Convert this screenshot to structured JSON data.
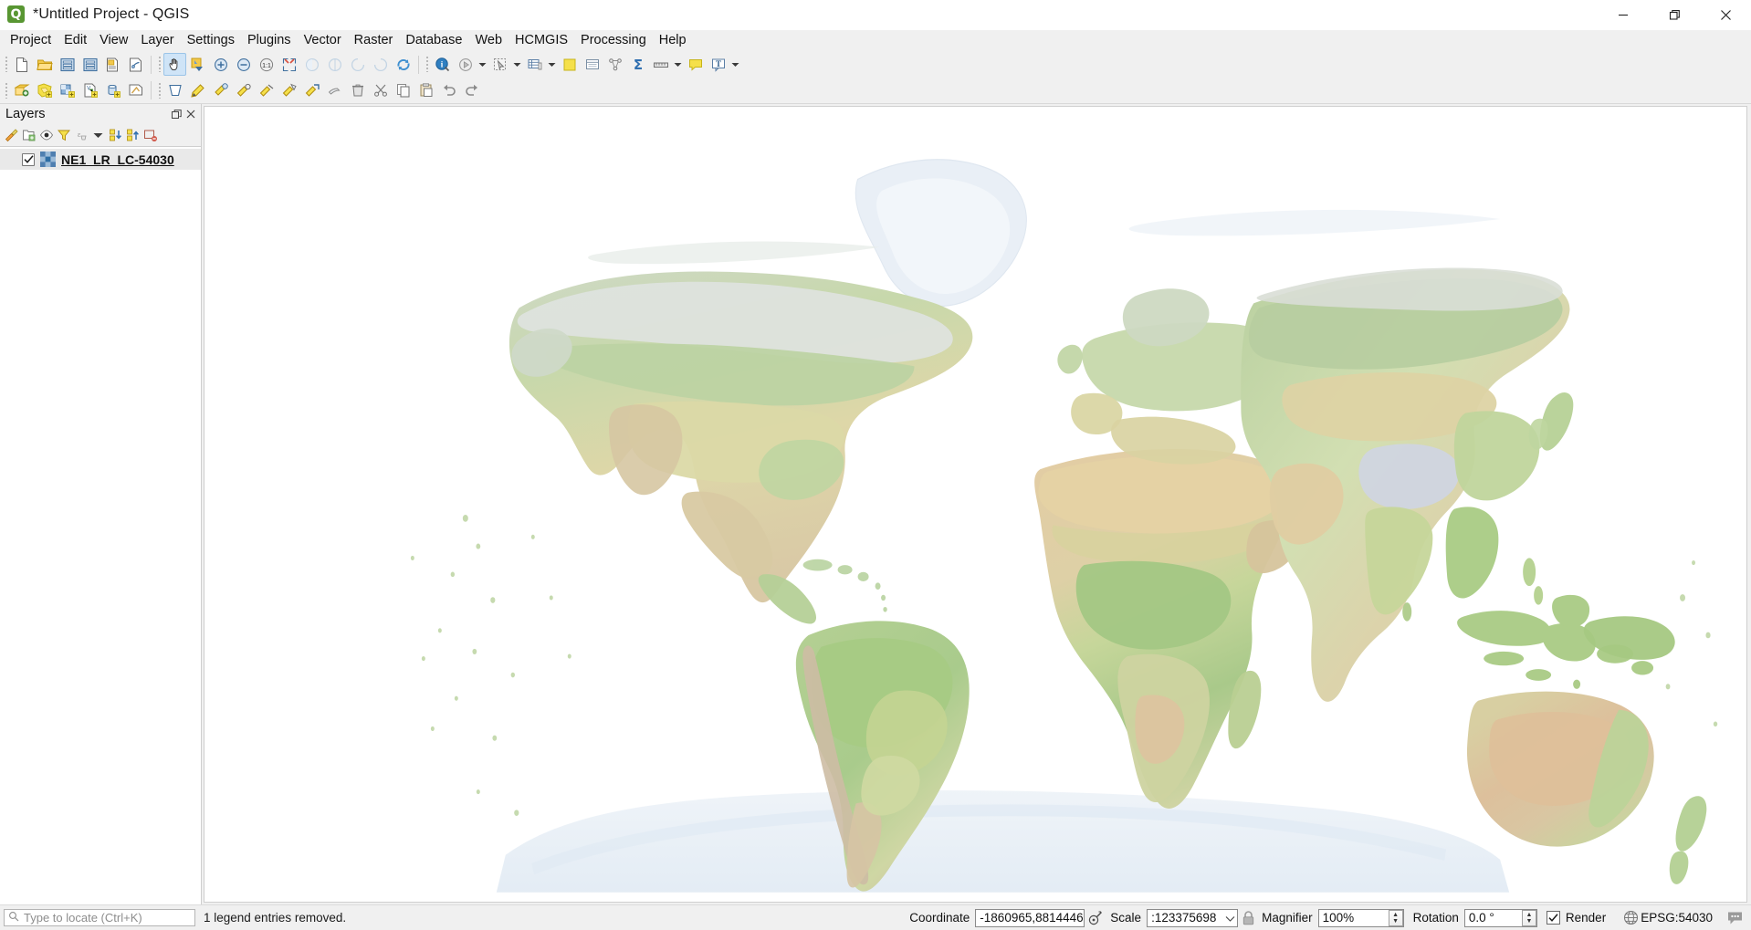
{
  "window": {
    "title": "*Untitled Project - QGIS",
    "app_icon": "qgis-logo-icon",
    "minimize_label": "Minimize",
    "maximize_label": "Restore",
    "close_label": "Close"
  },
  "menubar": {
    "items": [
      {
        "label": "Project"
      },
      {
        "label": "Edit"
      },
      {
        "label": "View"
      },
      {
        "label": "Layer"
      },
      {
        "label": "Settings"
      },
      {
        "label": "Plugins"
      },
      {
        "label": "Vector"
      },
      {
        "label": "Raster"
      },
      {
        "label": "Database"
      },
      {
        "label": "Web"
      },
      {
        "label": "HCMGIS"
      },
      {
        "label": "Processing"
      },
      {
        "label": "Help"
      }
    ]
  },
  "toolbar_project": {
    "buttons": [
      {
        "name": "new-project-icon",
        "tip": "New Project"
      },
      {
        "name": "open-project-icon",
        "tip": "Open Project"
      },
      {
        "name": "save-project-icon",
        "tip": "Save Project"
      },
      {
        "name": "save-project-as-icon",
        "tip": "Save Project As"
      },
      {
        "name": "new-print-layout-icon",
        "tip": "New Print Layout"
      },
      {
        "name": "show-layout-manager-icon",
        "tip": "Show Layout Manager"
      }
    ]
  },
  "toolbar_navigation": {
    "buttons": [
      {
        "name": "pan-map-icon",
        "tip": "Pan Map",
        "active": true
      },
      {
        "name": "pan-to-selection-icon",
        "tip": "Pan Map to Selection"
      },
      {
        "name": "zoom-in-icon",
        "tip": "Zoom In"
      },
      {
        "name": "zoom-out-icon",
        "tip": "Zoom Out"
      },
      {
        "name": "zoom-native-icon",
        "tip": "Zoom to Native Resolution",
        "glyph": "1:1"
      },
      {
        "name": "zoom-full-icon",
        "tip": "Zoom Full"
      },
      {
        "name": "zoom-to-selection-icon",
        "tip": "Zoom to Selection"
      },
      {
        "name": "zoom-to-layer-icon",
        "tip": "Zoom to Layer"
      },
      {
        "name": "zoom-last-icon",
        "tip": "Zoom Last"
      },
      {
        "name": "zoom-next-icon",
        "tip": "Zoom Next"
      },
      {
        "name": "refresh-icon",
        "tip": "Refresh"
      }
    ]
  },
  "toolbar_attributes": {
    "buttons": [
      {
        "name": "identify-features-icon",
        "tip": "Identify Features"
      },
      {
        "name": "run-feature-action-icon",
        "tip": "Run Feature Action",
        "has_arrow": true
      },
      {
        "name": "select-features-icon",
        "tip": "Select Features by Area",
        "has_arrow": true
      },
      {
        "name": "open-attribute-table-icon",
        "tip": "Open Attribute Table",
        "has_arrow": true
      },
      {
        "name": "deselect-features-icon",
        "tip": "Deselect Features"
      },
      {
        "name": "select-by-expression-icon",
        "tip": "Select by Expression"
      },
      {
        "name": "field-calculator-icon",
        "tip": "Open Field Calculator"
      },
      {
        "name": "statistical-summary-icon",
        "tip": "Show Statistical Summary",
        "glyph": "Σ"
      },
      {
        "name": "measure-line-icon",
        "tip": "Measure Line",
        "has_arrow": true
      },
      {
        "name": "map-tips-icon",
        "tip": "Show Map Tips"
      },
      {
        "name": "new-text-annotation-icon",
        "tip": "Text Annotation",
        "glyph": "T",
        "has_arrow": true
      }
    ]
  },
  "toolbar_datasource": {
    "buttons": [
      {
        "name": "data-source-manager-icon",
        "tip": "Open Data Source Manager"
      },
      {
        "name": "add-vector-layer-icon",
        "tip": "Add Vector Layer"
      },
      {
        "name": "add-raster-layer-icon",
        "tip": "Add Raster Layer"
      },
      {
        "name": "add-delimited-text-layer-icon",
        "tip": "Add Delimited Text Layer"
      },
      {
        "name": "add-postgis-layer-icon",
        "tip": "Add PostGIS Layer"
      },
      {
        "name": "new-shapefile-layer-icon",
        "tip": "New Shapefile Layer"
      }
    ]
  },
  "toolbar_digitizing": {
    "buttons": [
      {
        "name": "current-edits-icon",
        "tip": "Current Edits"
      },
      {
        "name": "toggle-editing-icon",
        "tip": "Toggle Editing"
      },
      {
        "name": "save-layer-edits-icon",
        "tip": "Save Layer Edits"
      },
      {
        "name": "add-point-feature-icon",
        "tip": "Add Point Feature"
      },
      {
        "name": "add-line-feature-icon",
        "tip": "Add Line Feature"
      },
      {
        "name": "add-polygon-feature-icon",
        "tip": "Add Polygon Feature"
      },
      {
        "name": "vertex-tool-icon",
        "tip": "Vertex Tool"
      },
      {
        "name": "modify-attributes-icon",
        "tip": "Modify Attributes of Selected Features"
      },
      {
        "name": "delete-selected-icon",
        "tip": "Delete Selected"
      },
      {
        "name": "cut-features-icon",
        "tip": "Cut Features"
      },
      {
        "name": "copy-features-icon",
        "tip": "Copy Features"
      },
      {
        "name": "paste-features-icon",
        "tip": "Paste Features"
      },
      {
        "name": "undo-icon",
        "tip": "Undo"
      },
      {
        "name": "redo-icon",
        "tip": "Redo"
      }
    ]
  },
  "layers_panel": {
    "title": "Layers",
    "float_label": "Float panel",
    "close_label": "Close panel",
    "toolbar": [
      {
        "name": "open-layer-styling-panel-icon",
        "tip": "Open the Layer Styling panel"
      },
      {
        "name": "add-group-icon",
        "tip": "Add Group"
      },
      {
        "name": "manage-map-themes-icon",
        "tip": "Manage Map Themes"
      },
      {
        "name": "filter-legend-icon",
        "tip": "Filter Legend"
      },
      {
        "name": "filter-legend-expression-icon",
        "tip": "Filter Legend by Expression"
      },
      {
        "name": "filter-legend-dropdown-icon",
        "tip": "More filter options"
      },
      {
        "name": "expand-all-icon",
        "tip": "Expand All"
      },
      {
        "name": "collapse-all-icon",
        "tip": "Collapse All"
      },
      {
        "name": "remove-layer-icon",
        "tip": "Remove Layer/Group"
      }
    ],
    "layers": [
      {
        "name": "NE1_LR_LC-54030",
        "checked": true,
        "type": "raster",
        "selected": true
      }
    ]
  },
  "map": {
    "background_color": "#ffffff",
    "projection_note": "Eckert IV / World Robinson style world raster",
    "palette": {
      "land_green": "#c3d9a8",
      "land_dark_green": "#9cc08a",
      "land_tan": "#e6e2b4",
      "land_desert": "#e3cfa8",
      "land_arid": "#ddbfa4",
      "ice": "#eef2f6",
      "snow": "#e8eef4",
      "highland": "#cdbba1"
    }
  },
  "statusbar": {
    "locator_placeholder": "Type to locate (Ctrl+K)",
    "locator_value": "",
    "locator_icon": "search-icon",
    "message": "1 legend entries removed.",
    "coordinate_label": "Coordinate",
    "coordinate_value": "-1860965,8814446",
    "coordinate_toggle_icon": "toggle-extents-icon",
    "scale_label": "Scale",
    "scale_value": ":123375698",
    "scale_lock_icon": "lock-icon",
    "magnifier_label": "Magnifier",
    "magnifier_value": "100%",
    "rotation_label": "Rotation",
    "rotation_value": "0.0 °",
    "render_label": "Render",
    "render_checked": true,
    "crs_label": "EPSG:54030",
    "crs_icon": "globe-icon",
    "messages_icon": "messages-log-icon"
  }
}
